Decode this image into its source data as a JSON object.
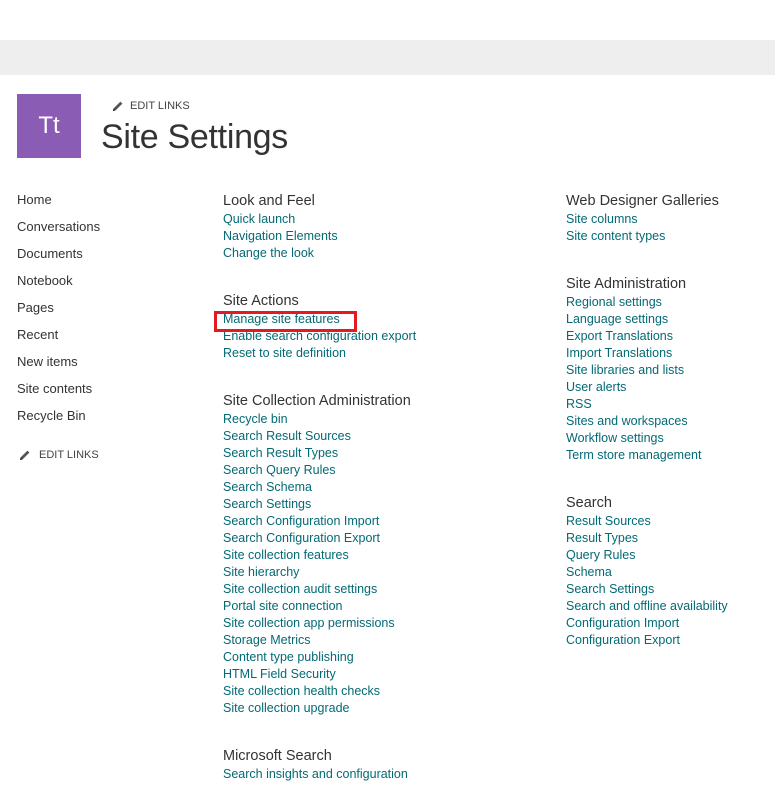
{
  "site": {
    "logo_text": "Tt",
    "title": "Site Settings",
    "edit_links_label": "EDIT LINKS"
  },
  "leftnav": {
    "items": [
      "Home",
      "Conversations",
      "Documents",
      "Notebook",
      "Pages",
      "Recent",
      "New items",
      "Site contents",
      "Recycle Bin"
    ],
    "edit_links_label": "EDIT LINKS"
  },
  "sections": {
    "look_and_feel": {
      "title": "Look and Feel",
      "links": [
        "Quick launch",
        "Navigation Elements",
        "Change the look"
      ]
    },
    "site_actions": {
      "title": "Site Actions",
      "links": [
        "Manage site features",
        "Enable search configuration export",
        "Reset to site definition"
      ]
    },
    "site_collection_admin": {
      "title": "Site Collection Administration",
      "links": [
        "Recycle bin",
        "Search Result Sources",
        "Search Result Types",
        "Search Query Rules",
        "Search Schema",
        "Search Settings",
        "Search Configuration Import",
        "Search Configuration Export",
        "Site collection features",
        "Site hierarchy",
        "Site collection audit settings",
        "Portal site connection",
        "Site collection app permissions",
        "Storage Metrics",
        "Content type publishing",
        "HTML Field Security",
        "Site collection health checks",
        "Site collection upgrade"
      ]
    },
    "microsoft_search": {
      "title": "Microsoft Search",
      "links": [
        "Search insights and configuration"
      ]
    },
    "web_designer_galleries": {
      "title": "Web Designer Galleries",
      "links": [
        "Site columns",
        "Site content types"
      ]
    },
    "site_administration": {
      "title": "Site Administration",
      "links": [
        "Regional settings",
        "Language settings",
        "Export Translations",
        "Import Translations",
        "Site libraries and lists",
        "User alerts",
        "RSS",
        "Sites and workspaces",
        "Workflow settings",
        "Term store management"
      ]
    },
    "search": {
      "title": "Search",
      "links": [
        "Result Sources",
        "Result Types",
        "Query Rules",
        "Schema",
        "Search Settings",
        "Search and offline availability",
        "Configuration Import",
        "Configuration Export"
      ]
    }
  },
  "colors": {
    "link": "#036a75",
    "logo_bg": "#8a5cb3",
    "highlight": "#e21b22"
  }
}
